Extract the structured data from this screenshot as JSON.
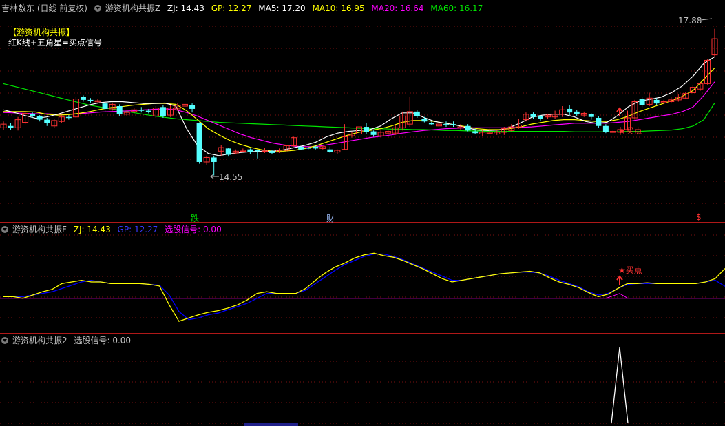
{
  "main_header": {
    "stock_name": "吉林敖东 (日线 前复权)",
    "indicator_name": "游资机构共振Z",
    "zj": "ZJ: 14.43",
    "gp": "GP: 12.27",
    "ma5": "MA5: 17.20",
    "ma10": "MA10: 16.95",
    "ma20": "MA20: 16.64",
    "ma60": "MA60: 16.17"
  },
  "legend_box": {
    "title": "【游资机构共振】",
    "desc": "红K线+五角星=买点信号"
  },
  "price_labels": {
    "high": "17.88",
    "low": "14.55"
  },
  "markers": {
    "buy_main": "★买点",
    "buy_sub": "★买点",
    "event_die": "跌",
    "event_cai": "财",
    "event_dollar": "$"
  },
  "sub1_header": {
    "name": "游资机构共振F",
    "zj": "ZJ: 14.43",
    "gp": "GP: 12.27",
    "signal": "选股信号: 0.00"
  },
  "sub2_header": {
    "name": "游资机构共振2",
    "signal": "选股信号: 0.00"
  },
  "colors": {
    "up": "#ff3232",
    "down": "#54ffff",
    "ma5": "#ffffff",
    "ma10": "#ffff00",
    "ma20": "#ff00ff",
    "ma60": "#00e600",
    "zj": "#ffff00",
    "gp": "#0000ff",
    "signal": "#ff00ff"
  },
  "chart_data": {
    "type": "candlestick",
    "candles": [
      [
        15.62,
        15.7,
        15.58,
        15.76
      ],
      [
        15.66,
        15.62,
        15.58,
        15.72
      ],
      [
        15.62,
        15.8,
        15.56,
        15.86
      ],
      [
        15.74,
        15.94,
        15.7,
        15.98
      ],
      [
        15.92,
        15.88,
        15.84,
        15.96
      ],
      [
        15.88,
        15.8,
        15.76,
        15.9
      ],
      [
        15.8,
        15.72,
        15.66,
        15.84
      ],
      [
        15.66,
        15.78,
        15.62,
        15.82
      ],
      [
        15.76,
        15.86,
        15.72,
        15.9
      ],
      [
        15.86,
        15.84,
        15.8,
        15.9
      ],
      [
        15.86,
        16.26,
        15.84,
        16.3
      ],
      [
        16.3,
        16.24,
        16.2,
        16.34
      ],
      [
        16.24,
        16.22,
        16.18,
        16.28
      ],
      [
        16.22,
        16.22,
        16.18,
        16.26
      ],
      [
        16.16,
        16.04,
        15.98,
        16.22
      ],
      [
        16.04,
        16.14,
        16.0,
        16.18
      ],
      [
        16.1,
        15.92,
        15.88,
        16.14
      ],
      [
        15.92,
        15.96,
        15.88,
        16.02
      ],
      [
        15.98,
        16.02,
        15.94,
        16.06
      ],
      [
        16.02,
        16.0,
        15.96,
        16.08
      ],
      [
        16.0,
        15.98,
        15.94,
        16.04
      ],
      [
        15.88,
        16.06,
        15.84,
        16.1
      ],
      [
        16.08,
        15.88,
        15.84,
        16.12
      ],
      [
        15.9,
        16.06,
        15.86,
        16.12
      ],
      [
        16.04,
        16.12,
        16.0,
        16.16
      ],
      [
        16.1,
        16.14,
        16.08,
        16.18
      ],
      [
        16.12,
        16.04,
        15.96,
        16.16
      ],
      [
        15.72,
        14.86,
        14.82,
        15.74
      ],
      [
        14.86,
        14.96,
        14.8,
        15.0
      ],
      [
        14.96,
        14.86,
        14.56,
        15.0
      ],
      [
        15.1,
        15.18,
        15.0,
        15.24
      ],
      [
        15.16,
        15.02,
        14.98,
        15.18
      ],
      [
        15.06,
        15.1,
        15.04,
        15.14
      ],
      [
        15.12,
        15.12,
        15.08,
        15.16
      ],
      [
        15.14,
        15.08,
        15.04,
        15.16
      ],
      [
        15.12,
        15.1,
        14.94,
        15.14
      ],
      [
        15.1,
        15.12,
        15.06,
        15.18
      ],
      [
        15.1,
        15.06,
        15.04,
        15.12
      ],
      [
        15.08,
        15.12,
        15.06,
        15.16
      ],
      [
        15.12,
        15.22,
        15.1,
        15.24
      ],
      [
        15.22,
        15.4,
        15.2,
        15.42
      ],
      [
        15.2,
        15.14,
        15.12,
        15.2
      ],
      [
        15.18,
        15.16,
        15.14,
        15.2
      ],
      [
        15.2,
        15.16,
        15.14,
        15.22
      ],
      [
        15.16,
        15.2,
        15.14,
        15.2
      ],
      [
        15.14,
        15.08,
        15.06,
        15.2
      ],
      [
        15.08,
        15.12,
        15.04,
        15.14
      ],
      [
        15.14,
        15.42,
        15.14,
        15.7
      ],
      [
        15.44,
        15.48,
        15.4,
        15.52
      ],
      [
        15.48,
        15.64,
        15.44,
        15.7
      ],
      [
        15.64,
        15.52,
        15.48,
        15.72
      ],
      [
        15.54,
        15.46,
        15.42,
        15.56
      ],
      [
        15.44,
        15.52,
        15.42,
        15.56
      ],
      [
        15.5,
        15.54,
        15.48,
        15.58
      ],
      [
        15.5,
        15.62,
        15.46,
        15.68
      ],
      [
        15.62,
        15.88,
        15.56,
        15.98
      ],
      [
        15.7,
        15.98,
        15.64,
        16.3
      ],
      [
        15.98,
        15.88,
        15.84,
        16.02
      ],
      [
        15.82,
        15.76,
        15.74,
        15.86
      ],
      [
        15.72,
        15.7,
        15.68,
        15.76
      ],
      [
        15.66,
        15.7,
        15.64,
        15.74
      ],
      [
        15.7,
        15.68,
        15.64,
        15.76
      ],
      [
        15.7,
        15.68,
        15.64,
        15.76
      ],
      [
        15.62,
        15.64,
        15.58,
        15.7
      ],
      [
        15.66,
        15.56,
        15.54,
        15.7
      ],
      [
        15.54,
        15.5,
        15.48,
        15.6
      ],
      [
        15.48,
        15.52,
        15.44,
        15.58
      ],
      [
        15.5,
        15.52,
        15.48,
        15.6
      ],
      [
        15.48,
        15.52,
        15.46,
        15.56
      ],
      [
        15.52,
        15.6,
        15.46,
        15.64
      ],
      [
        15.56,
        15.64,
        15.54,
        15.7
      ],
      [
        15.64,
        15.68,
        15.6,
        15.82
      ],
      [
        15.8,
        15.92,
        15.76,
        15.96
      ],
      [
        15.92,
        15.86,
        15.82,
        15.96
      ],
      [
        15.88,
        15.82,
        15.78,
        15.9
      ],
      [
        15.86,
        15.9,
        15.82,
        15.92
      ],
      [
        15.86,
        15.92,
        15.82,
        16.0
      ],
      [
        15.92,
        16.02,
        15.86,
        16.1
      ],
      [
        16.04,
        15.96,
        15.9,
        16.12
      ],
      [
        15.98,
        15.92,
        15.88,
        16.02
      ],
      [
        15.9,
        15.94,
        15.86,
        15.98
      ],
      [
        15.92,
        15.86,
        15.8,
        15.94
      ],
      [
        15.84,
        15.66,
        15.62,
        15.88
      ],
      [
        15.66,
        15.52,
        15.5,
        15.7
      ],
      [
        15.52,
        15.54,
        15.5,
        15.58
      ],
      [
        15.52,
        15.58,
        15.46,
        15.64
      ],
      [
        15.58,
        15.84,
        15.56,
        16.0
      ],
      [
        15.84,
        16.2,
        15.8,
        16.24
      ],
      [
        16.26,
        16.12,
        16.08,
        16.3
      ],
      [
        16.14,
        16.28,
        16.1,
        16.4
      ],
      [
        16.24,
        16.16,
        16.12,
        16.28
      ],
      [
        16.18,
        16.2,
        16.14,
        16.24
      ],
      [
        16.2,
        16.24,
        16.16,
        16.3
      ],
      [
        16.24,
        16.3,
        16.2,
        16.36
      ],
      [
        16.28,
        16.38,
        16.26,
        16.42
      ],
      [
        16.4,
        16.52,
        16.36,
        16.56
      ],
      [
        16.48,
        16.6,
        16.44,
        16.64
      ],
      [
        16.6,
        17.12,
        16.58,
        17.14
      ],
      [
        17.24,
        17.6,
        17.2,
        17.82
      ]
    ],
    "ma5": [
      16.02,
      15.96,
      15.89,
      15.83,
      15.86,
      15.92,
      15.99,
      16.06,
      16.13,
      16.18,
      16.2,
      16.2,
      16.18,
      16.16,
      16.16,
      16.17,
      16.1,
      15.6,
      15.23,
      15.05,
      15.0,
      15.04,
      15.07,
      15.09,
      15.1,
      15.1,
      15.13,
      15.18,
      15.23,
      15.3,
      15.42,
      15.5,
      15.54,
      15.56,
      15.58,
      15.66,
      15.82,
      15.95,
      15.95,
      15.85,
      15.76,
      15.72,
      15.68,
      15.62,
      15.57,
      15.56,
      15.57,
      15.63,
      15.73,
      15.85,
      15.9,
      15.92,
      15.92,
      15.86,
      15.76,
      15.72,
      15.74,
      15.89,
      16.09,
      16.21,
      16.25,
      16.3,
      16.4,
      16.55,
      16.77,
      17.05,
      17.2
    ],
    "ma10": [
      15.98,
      15.98,
      15.98,
      15.97,
      15.92,
      15.9,
      15.91,
      15.94,
      15.98,
      16.03,
      16.07,
      16.09,
      16.12,
      16.14,
      16.16,
      16.16,
      16.14,
      16.0,
      15.8,
      15.6,
      15.46,
      15.34,
      15.25,
      15.18,
      15.13,
      15.1,
      15.1,
      15.12,
      15.16,
      15.22,
      15.3,
      15.38,
      15.46,
      15.52,
      15.56,
      15.6,
      15.66,
      15.74,
      15.78,
      15.78,
      15.76,
      15.72,
      15.68,
      15.64,
      15.6,
      15.58,
      15.58,
      15.6,
      15.64,
      15.7,
      15.74,
      15.78,
      15.8,
      15.8,
      15.78,
      15.76,
      15.76,
      15.8,
      15.88,
      15.98,
      16.06,
      16.14,
      16.22,
      16.32,
      16.45,
      16.7,
      16.95
    ],
    "ma20": [
      15.96,
      15.95,
      15.94,
      15.93,
      15.93,
      15.92,
      15.92,
      15.93,
      15.95,
      15.97,
      15.98,
      15.99,
      16.0,
      16.02,
      16.03,
      16.04,
      16.02,
      15.96,
      15.88,
      15.78,
      15.68,
      15.58,
      15.48,
      15.4,
      15.34,
      15.28,
      15.24,
      15.21,
      15.2,
      15.2,
      15.24,
      15.28,
      15.32,
      15.36,
      15.4,
      15.43,
      15.46,
      15.5,
      15.53,
      15.56,
      15.58,
      15.6,
      15.61,
      15.62,
      15.62,
      15.62,
      15.62,
      15.62,
      15.63,
      15.64,
      15.66,
      15.68,
      15.7,
      15.72,
      15.72,
      15.72,
      15.72,
      15.74,
      15.76,
      15.8,
      15.84,
      15.88,
      15.92,
      15.98,
      16.08,
      16.34,
      16.64
    ],
    "ma60": [
      16.6,
      16.54,
      16.48,
      16.42,
      16.36,
      16.3,
      16.24,
      16.18,
      16.12,
      16.08,
      16.04,
      16.0,
      15.96,
      15.92,
      15.88,
      15.85,
      15.82,
      15.8,
      15.78,
      15.76,
      15.74,
      15.73,
      15.72,
      15.71,
      15.7,
      15.69,
      15.68,
      15.67,
      15.66,
      15.65,
      15.64,
      15.63,
      15.62,
      15.61,
      15.6,
      15.6,
      15.59,
      15.59,
      15.58,
      15.58,
      15.57,
      15.56,
      15.56,
      15.55,
      15.55,
      15.54,
      15.54,
      15.54,
      15.54,
      15.54,
      15.54,
      15.54,
      15.54,
      15.53,
      15.53,
      15.53,
      15.53,
      15.53,
      15.54,
      15.54,
      15.55,
      15.56,
      15.57,
      15.6,
      15.66,
      15.8,
      16.17
    ],
    "zj": [
      11.0,
      11.0,
      10.8,
      11.2,
      11.6,
      11.9,
      12.6,
      12.8,
      13.0,
      12.8,
      12.8,
      12.6,
      12.6,
      12.6,
      12.6,
      12.5,
      12.3,
      10.0,
      8.0,
      8.4,
      8.8,
      9.1,
      9.3,
      9.6,
      10.0,
      10.6,
      11.4,
      11.6,
      11.4,
      11.4,
      11.4,
      12.0,
      13.0,
      13.9,
      14.6,
      15.1,
      15.7,
      16.1,
      16.3,
      16.0,
      15.8,
      15.4,
      14.9,
      14.4,
      13.8,
      13.2,
      12.8,
      13.0,
      13.2,
      13.4,
      13.6,
      13.8,
      13.9,
      14.0,
      14.1,
      13.9,
      13.3,
      12.8,
      12.5,
      12.1,
      11.5,
      11.0,
      11.3,
      12.0,
      12.6,
      12.6,
      12.7,
      12.6,
      12.6,
      12.6,
      12.6,
      12.6,
      12.8,
      13.2,
      14.43
    ],
    "gp": [
      11.0,
      11.0,
      11.0,
      11.2,
      11.4,
      11.6,
      12.0,
      12.4,
      12.8,
      13.0,
      12.8,
      12.6,
      12.6,
      12.6,
      12.6,
      12.5,
      12.4,
      11.2,
      9.2,
      8.2,
      8.4,
      8.8,
      9.0,
      9.4,
      9.8,
      10.2,
      10.8,
      11.4,
      11.4,
      11.4,
      11.4,
      11.8,
      12.6,
      13.4,
      14.2,
      14.9,
      15.4,
      15.9,
      16.2,
      16.2,
      15.9,
      15.5,
      15.0,
      14.5,
      14.0,
      13.5,
      13.0,
      13.0,
      13.2,
      13.4,
      13.6,
      13.8,
      13.9,
      14.0,
      14.0,
      13.9,
      13.5,
      13.0,
      12.6,
      12.2,
      11.6,
      11.2,
      11.4,
      12.0,
      12.5,
      12.6,
      12.6,
      12.6,
      12.6,
      12.6,
      12.6,
      12.6,
      12.8,
      13.0,
      12.27
    ]
  }
}
